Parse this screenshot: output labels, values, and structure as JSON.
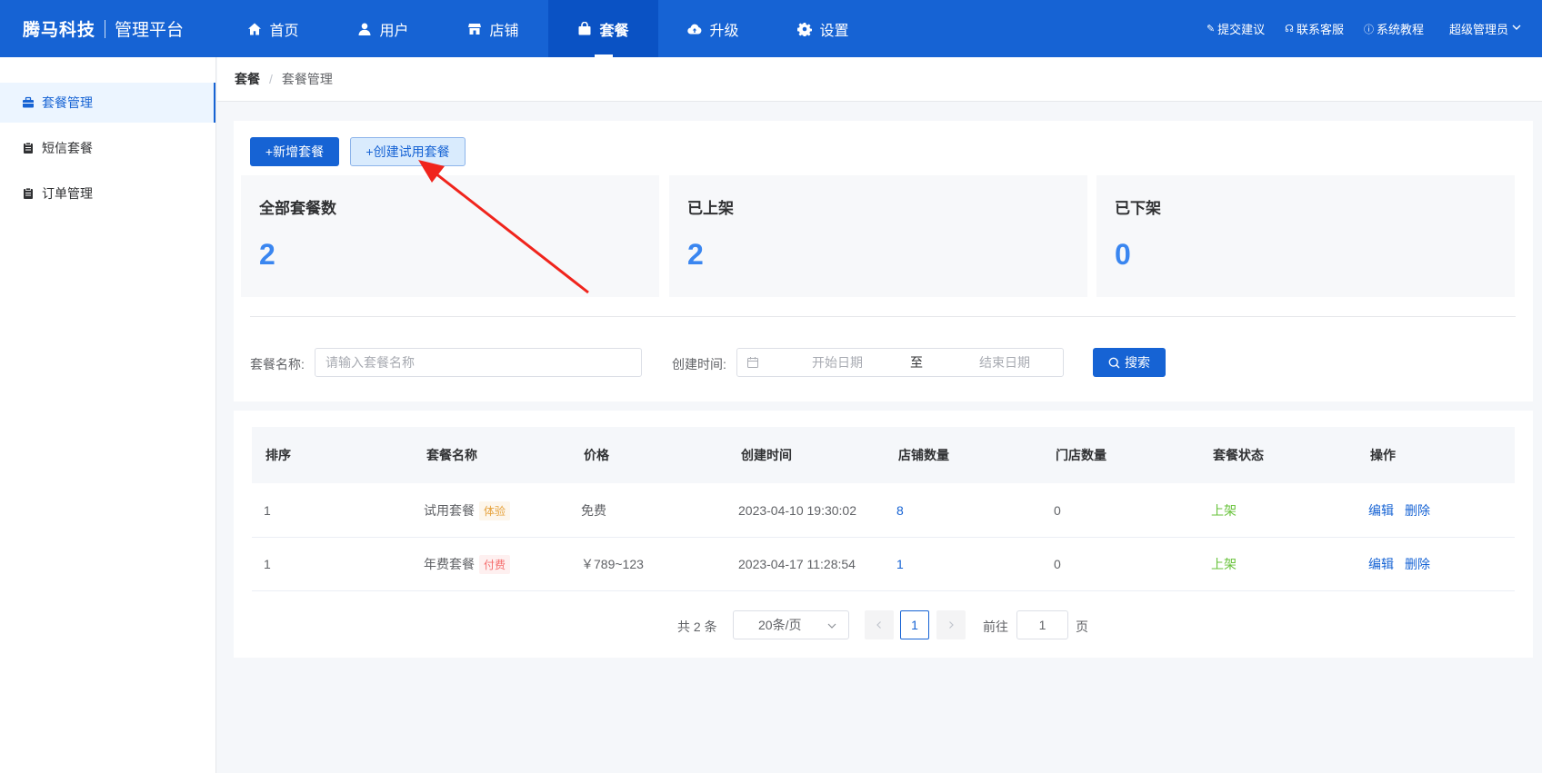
{
  "brand": {
    "company": "腾马科技",
    "platform": "管理平台"
  },
  "nav": {
    "items": [
      {
        "label": "首页",
        "icon": "home-icon"
      },
      {
        "label": "用户",
        "icon": "user-icon"
      },
      {
        "label": "店铺",
        "icon": "store-icon"
      },
      {
        "label": "套餐",
        "icon": "bag-icon",
        "active": true
      },
      {
        "label": "升级",
        "icon": "cloud-upload-icon"
      },
      {
        "label": "设置",
        "icon": "gear-icon"
      }
    ],
    "right": {
      "suggest": "提交建议",
      "service": "联系客服",
      "tutorial": "系统教程",
      "admin": "超级管理员"
    }
  },
  "sidebar": {
    "items": [
      {
        "label": "套餐管理",
        "active": true
      },
      {
        "label": "短信套餐"
      },
      {
        "label": "订单管理"
      }
    ]
  },
  "breadcrumb": {
    "level1": "套餐",
    "separator": "/",
    "level2": "套餐管理"
  },
  "actions": {
    "add": "+新增套餐",
    "create_trial": "+创建试用套餐"
  },
  "stats": [
    {
      "label": "全部套餐数",
      "value": "2"
    },
    {
      "label": "已上架",
      "value": "2"
    },
    {
      "label": "已下架",
      "value": "0"
    }
  ],
  "filters": {
    "name_label": "套餐名称:",
    "name_placeholder": "请输入套餐名称",
    "time_label": "创建时间:",
    "start_placeholder": "开始日期",
    "to": "至",
    "end_placeholder": "结束日期",
    "search": "搜索"
  },
  "table": {
    "headers": [
      "排序",
      "套餐名称",
      "价格",
      "创建时间",
      "店铺数量",
      "门店数量",
      "套餐状态",
      "操作"
    ],
    "rows": [
      {
        "order": "1",
        "name": "试用套餐",
        "tag": "体验",
        "price": "免费",
        "created": "2023-04-10 19:30:02",
        "stores": "8",
        "shops": "0",
        "status": "上架",
        "edit": "编辑",
        "delete": "删除"
      },
      {
        "order": "1",
        "name": "年费套餐",
        "tag": "付费",
        "price": "￥789~123",
        "created": "2023-04-17 11:28:54",
        "stores": "1",
        "shops": "0",
        "status": "上架",
        "edit": "编辑",
        "delete": "删除"
      }
    ]
  },
  "pagination": {
    "total": "共 2 条",
    "page_size": "20条/页",
    "current": "1",
    "goto_label": "前往",
    "goto_value": "1",
    "page_unit": "页"
  },
  "colors": {
    "primary": "#1663d4",
    "stat_value": "#3a86f0",
    "status_on": "#67c23a",
    "annotation_arrow": "#f0241c"
  }
}
